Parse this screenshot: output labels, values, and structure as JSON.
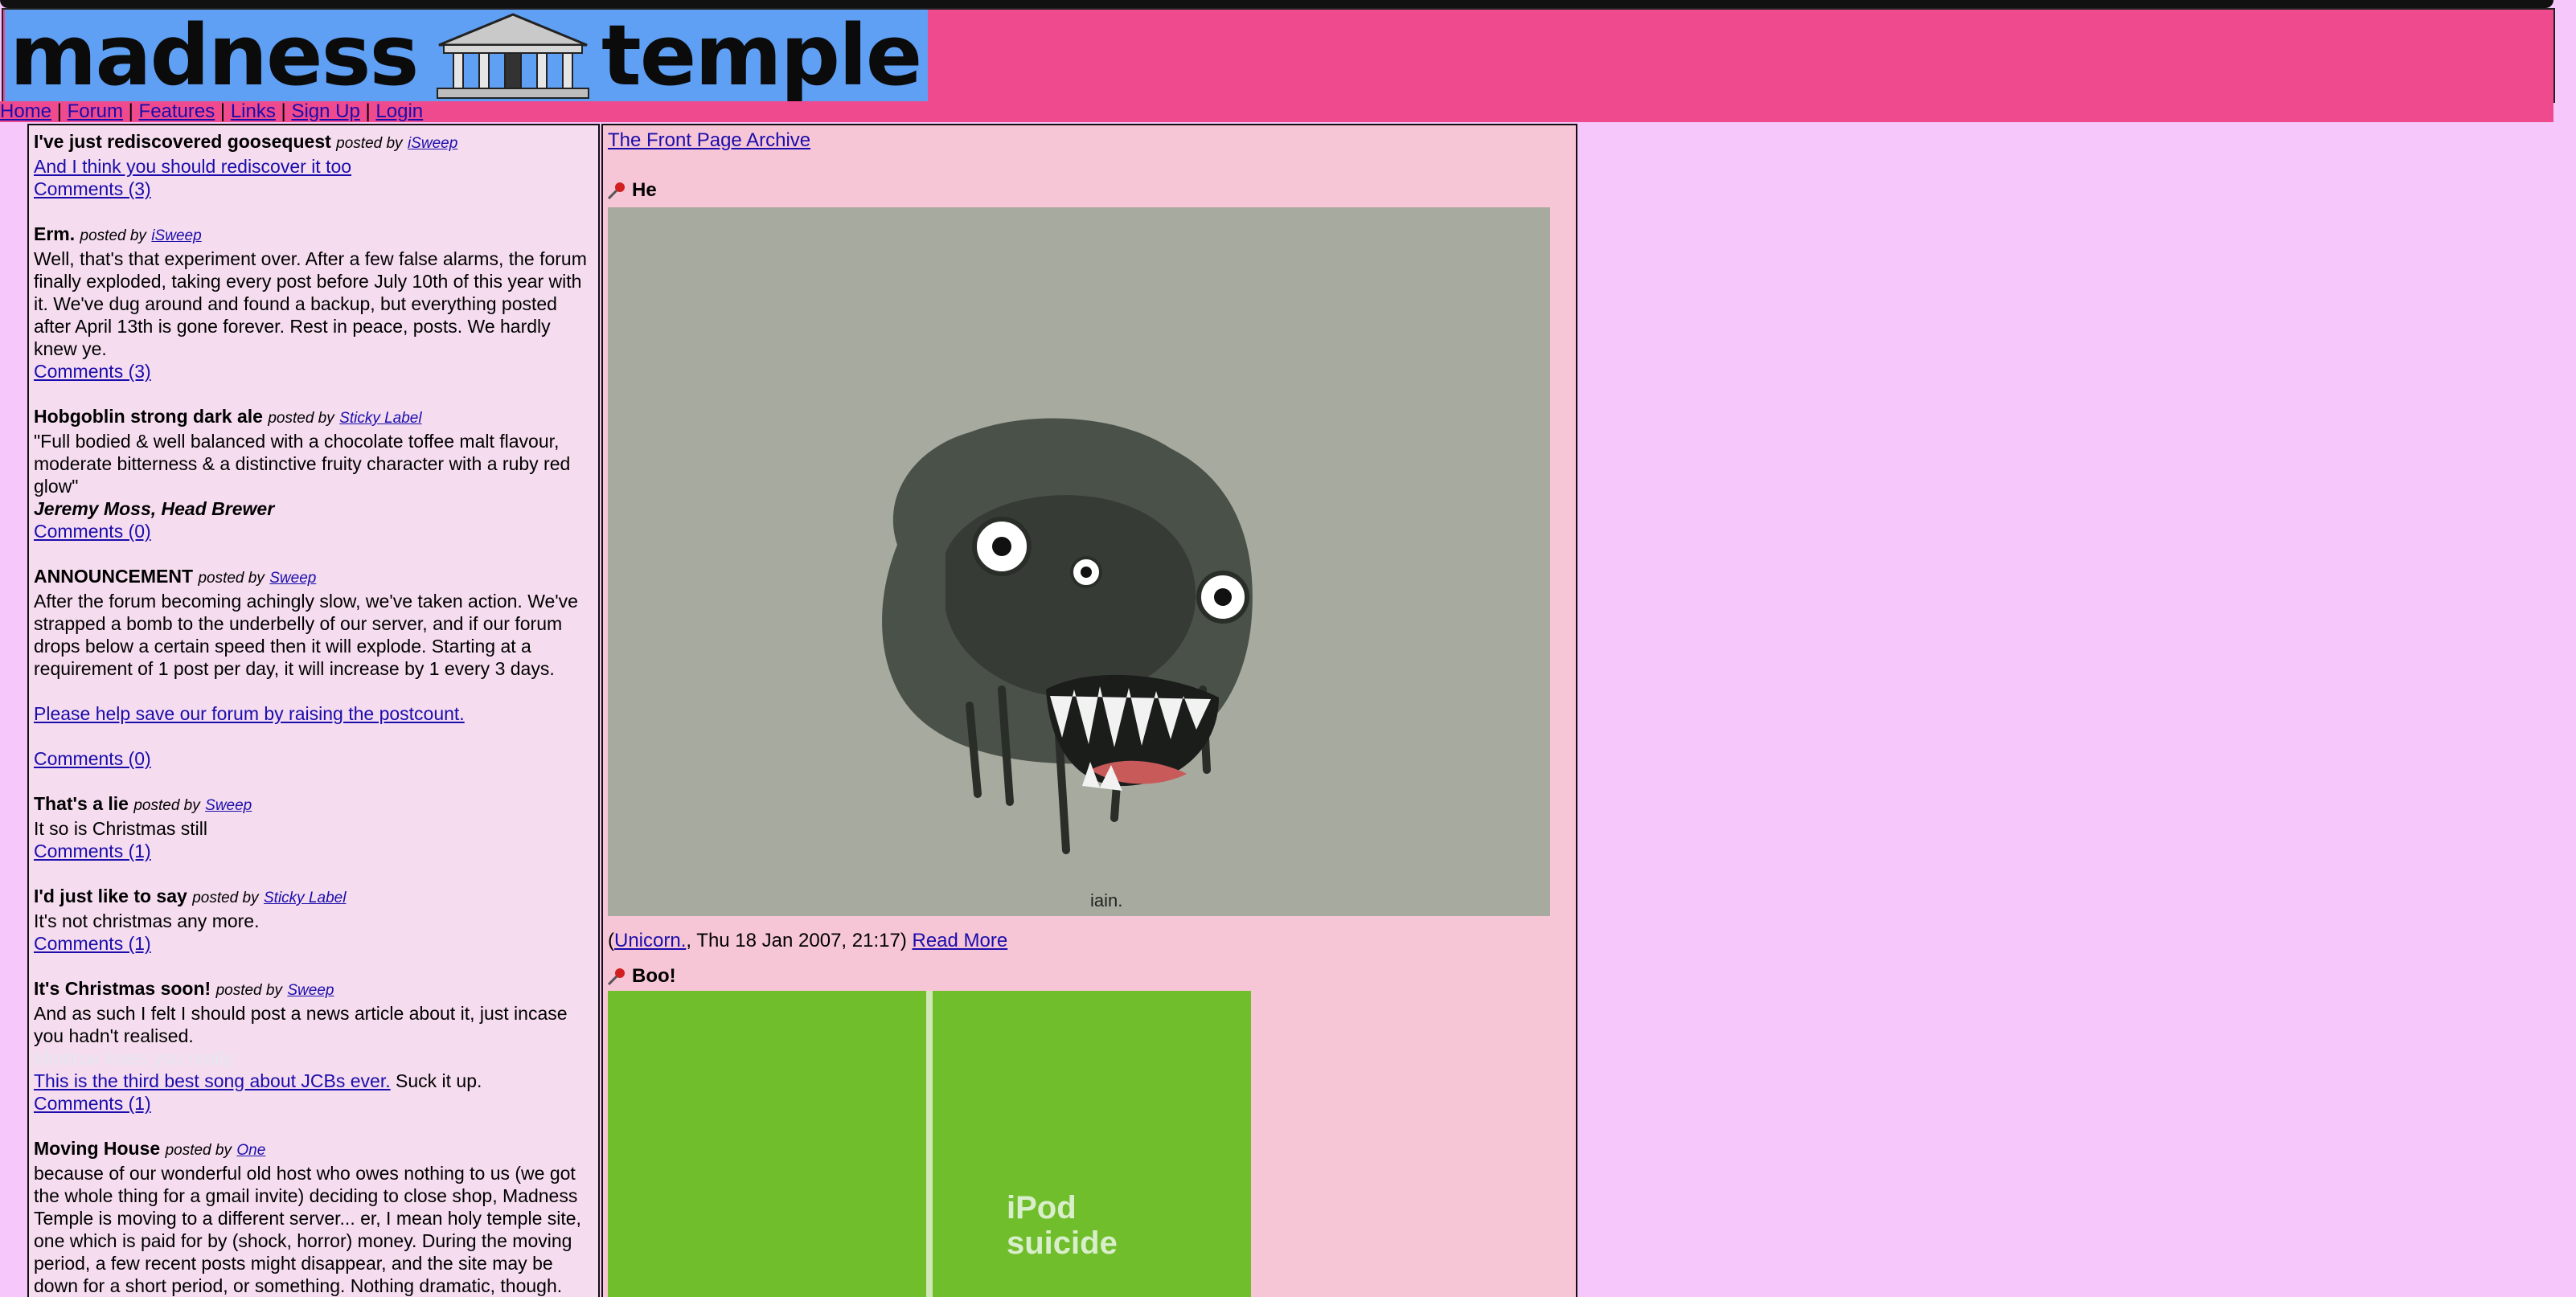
{
  "site": {
    "logo_left": "madness",
    "logo_right": "temple",
    "logo_alt": "Madness Temple",
    "colors": {
      "banner": "#ef4a8e",
      "logo_bg": "#5fa0f5",
      "page_bg": "#f5c7fb",
      "left_bg": "#f5dcef",
      "main_bg": "#f7c6d6"
    }
  },
  "nav": {
    "items": [
      "Home",
      "Forum",
      "Features",
      "Links",
      "Sign Up",
      "Login"
    ],
    "separator": "|"
  },
  "posts": [
    {
      "title": "I've just rediscovered goosequest",
      "posted_by": "posted by",
      "author": "iSweep",
      "link": "And I think you should rediscover it too",
      "comments": "Comments (3)"
    },
    {
      "title": "Erm.",
      "posted_by": "posted by",
      "author": "iSweep",
      "body": "Well, that's that experiment over. After a few false alarms, the forum finally exploded, taking every post before July 10th of this year with it. We've dug around and found a backup, but everything posted after April 13th is gone forever. Rest in peace, posts. We hardly knew ye.",
      "comments": "Comments (3)"
    },
    {
      "title": "Hobgoblin strong dark ale",
      "posted_by": "posted by",
      "author": "Sticky Label",
      "body": "\"Full bodied & well balanced with a chocolate toffee malt flavour, moderate bitterness & a distinctive fruity character with a ruby red glow\"",
      "signature": "Jeremy Moss, Head Brewer",
      "comments": "Comments (0)"
    },
    {
      "title": "ANNOUNCEMENT",
      "posted_by": "posted by",
      "author": "Sweep",
      "body": "After the forum becoming achingly slow, we've taken action. We've strapped a bomb to the underbelly of our server, and if our forum drops below a certain speed then it will explode. Starting at a requirement of 1 post per day, it will increase by 1 every 3 days.",
      "link": "Please help save our forum by raising the postcount.",
      "comments": "Comments (0)"
    },
    {
      "title": "That's a lie",
      "posted_by": "posted by",
      "author": "Sweep",
      "body": "It so is Christmas still",
      "comments": "Comments (1)"
    },
    {
      "title": "I'd just like to say",
      "posted_by": "posted by",
      "author": "Sticky Label",
      "body": "It's not christmas any more.",
      "comments": "Comments (1)"
    },
    {
      "title": "It's Christmas soon!",
      "posted_by": "posted by",
      "author": "Sweep",
      "body": "And as such I felt I should post a news article about it, just incase you hadn't realised.",
      "hidden": "Minitrue loves you really.",
      "link": "This is the third best song about JCBs ever.",
      "after_link": " Suck it up.",
      "comments": "Comments (1)"
    },
    {
      "title": "Moving House",
      "posted_by": "posted by",
      "author": "One",
      "body": "because of our wonderful old host who owes nothing to us (we got the whole thing for a gmail invite) deciding to close shop, Madness Temple is moving to a different server... er, I mean holy temple site, one which is paid for by (shock, horror) money. During the moving period, a few recent posts might disappear, and the site may be down for a short period, or something. Nothing dramatic, though."
    }
  ],
  "main": {
    "archive_link": "The Front Page Archive",
    "entries": [
      {
        "title": "He",
        "icon": "pin-icon",
        "image_icon": "monster-drawing",
        "signature": "iain.",
        "meta_open": "(",
        "meta_author": "Unicorn.",
        "meta_date": ", Thu 18 Jan 2007, 21:17)",
        "read_more": "Read More"
      },
      {
        "title": "Boo!",
        "icon": "pin-icon",
        "image_text": "iPod suicide",
        "image_icon": "ipod-poster"
      }
    ]
  }
}
